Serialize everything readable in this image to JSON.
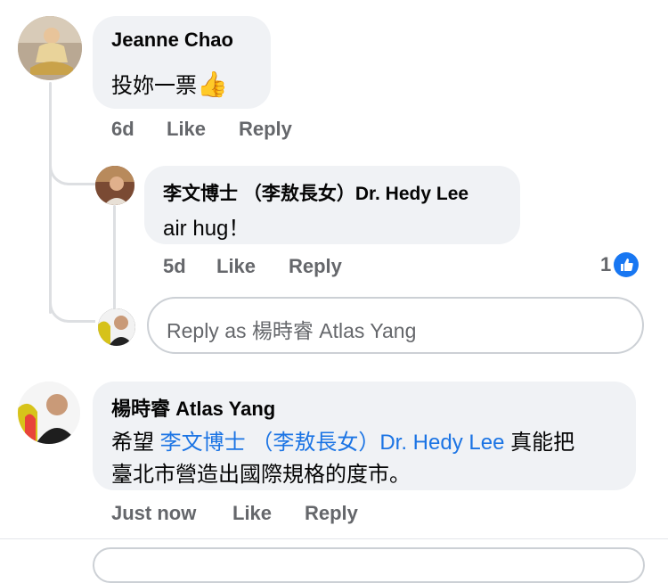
{
  "comments": [
    {
      "author": "Jeanne Chao",
      "text": "投妳一票",
      "emoji": "👍",
      "time": "6d",
      "like_label": "Like",
      "reply_label": "Reply"
    },
    {
      "author": "李文博士 （李敖長女）Dr. Hedy Lee",
      "text": "air hug！",
      "time": "5d",
      "like_label": "Like",
      "reply_label": "Reply",
      "reaction_count": "1"
    },
    {
      "author": "楊時睿 Atlas Yang",
      "text_before": "希望 ",
      "mention": "李文博士 （李敖長女）Dr. Hedy Lee",
      "text_after": " 真能把",
      "text_line2": "臺北市營造出國際規格的度市。",
      "time": "Just now",
      "like_label": "Like",
      "reply_label": "Reply"
    }
  ],
  "reply_box": {
    "placeholder": "Reply as 楊時睿 Atlas Yang"
  },
  "colors": {
    "bubble": "#f0f2f5",
    "meta_text": "#65676b",
    "link": "#1b74e4",
    "like_badge": "#1877f2"
  }
}
